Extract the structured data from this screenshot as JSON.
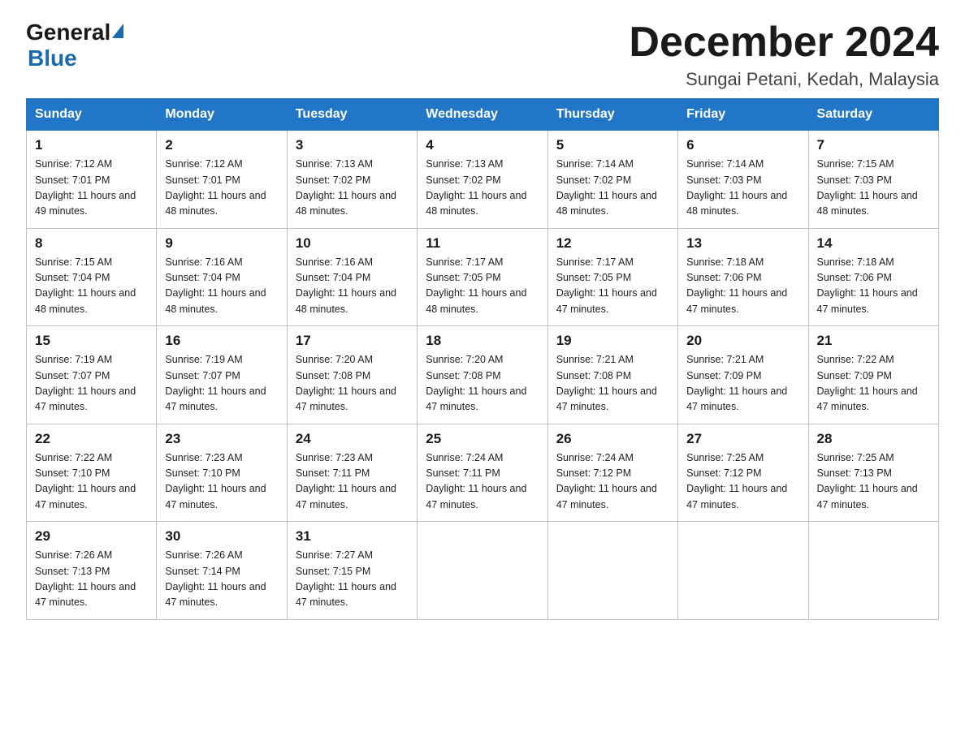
{
  "header": {
    "logo_general": "General",
    "logo_blue": "Blue",
    "main_title": "December 2024",
    "subtitle": "Sungai Petani, Kedah, Malaysia"
  },
  "weekdays": [
    "Sunday",
    "Monday",
    "Tuesday",
    "Wednesday",
    "Thursday",
    "Friday",
    "Saturday"
  ],
  "weeks": [
    [
      {
        "day": "1",
        "sunrise": "7:12 AM",
        "sunset": "7:01 PM",
        "daylight": "11 hours and 49 minutes."
      },
      {
        "day": "2",
        "sunrise": "7:12 AM",
        "sunset": "7:01 PM",
        "daylight": "11 hours and 48 minutes."
      },
      {
        "day": "3",
        "sunrise": "7:13 AM",
        "sunset": "7:02 PM",
        "daylight": "11 hours and 48 minutes."
      },
      {
        "day": "4",
        "sunrise": "7:13 AM",
        "sunset": "7:02 PM",
        "daylight": "11 hours and 48 minutes."
      },
      {
        "day": "5",
        "sunrise": "7:14 AM",
        "sunset": "7:02 PM",
        "daylight": "11 hours and 48 minutes."
      },
      {
        "day": "6",
        "sunrise": "7:14 AM",
        "sunset": "7:03 PM",
        "daylight": "11 hours and 48 minutes."
      },
      {
        "day": "7",
        "sunrise": "7:15 AM",
        "sunset": "7:03 PM",
        "daylight": "11 hours and 48 minutes."
      }
    ],
    [
      {
        "day": "8",
        "sunrise": "7:15 AM",
        "sunset": "7:04 PM",
        "daylight": "11 hours and 48 minutes."
      },
      {
        "day": "9",
        "sunrise": "7:16 AM",
        "sunset": "7:04 PM",
        "daylight": "11 hours and 48 minutes."
      },
      {
        "day": "10",
        "sunrise": "7:16 AM",
        "sunset": "7:04 PM",
        "daylight": "11 hours and 48 minutes."
      },
      {
        "day": "11",
        "sunrise": "7:17 AM",
        "sunset": "7:05 PM",
        "daylight": "11 hours and 48 minutes."
      },
      {
        "day": "12",
        "sunrise": "7:17 AM",
        "sunset": "7:05 PM",
        "daylight": "11 hours and 47 minutes."
      },
      {
        "day": "13",
        "sunrise": "7:18 AM",
        "sunset": "7:06 PM",
        "daylight": "11 hours and 47 minutes."
      },
      {
        "day": "14",
        "sunrise": "7:18 AM",
        "sunset": "7:06 PM",
        "daylight": "11 hours and 47 minutes."
      }
    ],
    [
      {
        "day": "15",
        "sunrise": "7:19 AM",
        "sunset": "7:07 PM",
        "daylight": "11 hours and 47 minutes."
      },
      {
        "day": "16",
        "sunrise": "7:19 AM",
        "sunset": "7:07 PM",
        "daylight": "11 hours and 47 minutes."
      },
      {
        "day": "17",
        "sunrise": "7:20 AM",
        "sunset": "7:08 PM",
        "daylight": "11 hours and 47 minutes."
      },
      {
        "day": "18",
        "sunrise": "7:20 AM",
        "sunset": "7:08 PM",
        "daylight": "11 hours and 47 minutes."
      },
      {
        "day": "19",
        "sunrise": "7:21 AM",
        "sunset": "7:08 PM",
        "daylight": "11 hours and 47 minutes."
      },
      {
        "day": "20",
        "sunrise": "7:21 AM",
        "sunset": "7:09 PM",
        "daylight": "11 hours and 47 minutes."
      },
      {
        "day": "21",
        "sunrise": "7:22 AM",
        "sunset": "7:09 PM",
        "daylight": "11 hours and 47 minutes."
      }
    ],
    [
      {
        "day": "22",
        "sunrise": "7:22 AM",
        "sunset": "7:10 PM",
        "daylight": "11 hours and 47 minutes."
      },
      {
        "day": "23",
        "sunrise": "7:23 AM",
        "sunset": "7:10 PM",
        "daylight": "11 hours and 47 minutes."
      },
      {
        "day": "24",
        "sunrise": "7:23 AM",
        "sunset": "7:11 PM",
        "daylight": "11 hours and 47 minutes."
      },
      {
        "day": "25",
        "sunrise": "7:24 AM",
        "sunset": "7:11 PM",
        "daylight": "11 hours and 47 minutes."
      },
      {
        "day": "26",
        "sunrise": "7:24 AM",
        "sunset": "7:12 PM",
        "daylight": "11 hours and 47 minutes."
      },
      {
        "day": "27",
        "sunrise": "7:25 AM",
        "sunset": "7:12 PM",
        "daylight": "11 hours and 47 minutes."
      },
      {
        "day": "28",
        "sunrise": "7:25 AM",
        "sunset": "7:13 PM",
        "daylight": "11 hours and 47 minutes."
      }
    ],
    [
      {
        "day": "29",
        "sunrise": "7:26 AM",
        "sunset": "7:13 PM",
        "daylight": "11 hours and 47 minutes."
      },
      {
        "day": "30",
        "sunrise": "7:26 AM",
        "sunset": "7:14 PM",
        "daylight": "11 hours and 47 minutes."
      },
      {
        "day": "31",
        "sunrise": "7:27 AM",
        "sunset": "7:15 PM",
        "daylight": "11 hours and 47 minutes."
      },
      null,
      null,
      null,
      null
    ]
  ],
  "labels": {
    "sunrise": "Sunrise:",
    "sunset": "Sunset:",
    "daylight": "Daylight:"
  }
}
